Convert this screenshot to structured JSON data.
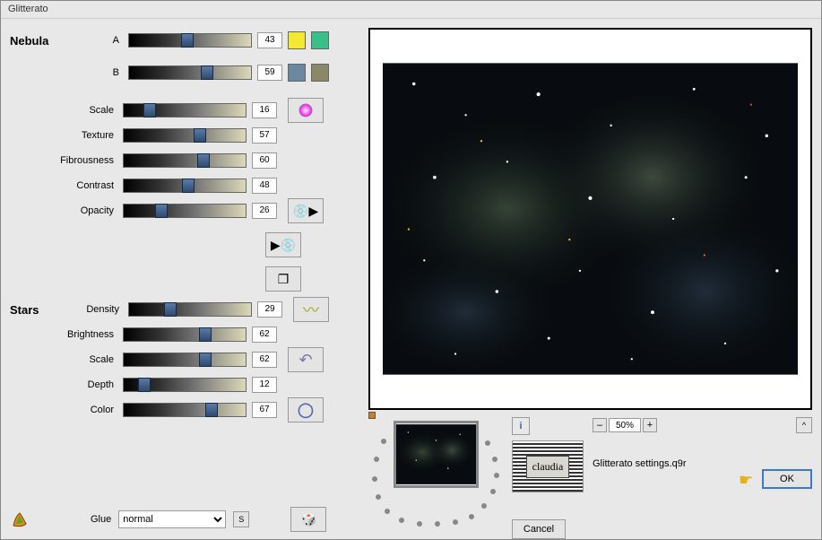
{
  "window": {
    "title": "Glitterato"
  },
  "nebula": {
    "title": "Nebula",
    "sliders": [
      {
        "label": "A",
        "value": 43
      },
      {
        "label": "B",
        "value": 59
      },
      {
        "label": "Scale",
        "value": 16
      },
      {
        "label": "Texture",
        "value": 57
      },
      {
        "label": "Fibrousness",
        "value": 60
      },
      {
        "label": "Contrast",
        "value": 48
      },
      {
        "label": "Opacity",
        "value": 26
      }
    ],
    "swatches": {
      "a": [
        "#f4e830",
        "#38c088"
      ],
      "b": [
        "#6a88a0",
        "#8a8868"
      ]
    },
    "hue_icon": "hue-icon"
  },
  "stars": {
    "title": "Stars",
    "sliders": [
      {
        "label": "Density",
        "value": 29
      },
      {
        "label": "Brightness",
        "value": 62
      },
      {
        "label": "Scale",
        "value": 62
      },
      {
        "label": "Depth",
        "value": 12
      },
      {
        "label": "Color",
        "value": 67
      }
    ]
  },
  "tools": {
    "disc_play": "disc-play-icon",
    "play_disc": "play-disc-icon",
    "copy": "copy-icon",
    "wave": "wave-icon",
    "undo": "undo-icon",
    "ring": "ring-icon",
    "dice": "dice-icon"
  },
  "glue": {
    "label": "Glue",
    "value": "normal",
    "options": [
      "normal"
    ],
    "s_btn": "S"
  },
  "zoom": {
    "minus": "–",
    "value": "50%",
    "plus": "+"
  },
  "settings_file": "Glitterato settings.q9r",
  "buttons": {
    "cancel": "Cancel",
    "ok": "OK",
    "caret": "^"
  },
  "logo": "claudia"
}
